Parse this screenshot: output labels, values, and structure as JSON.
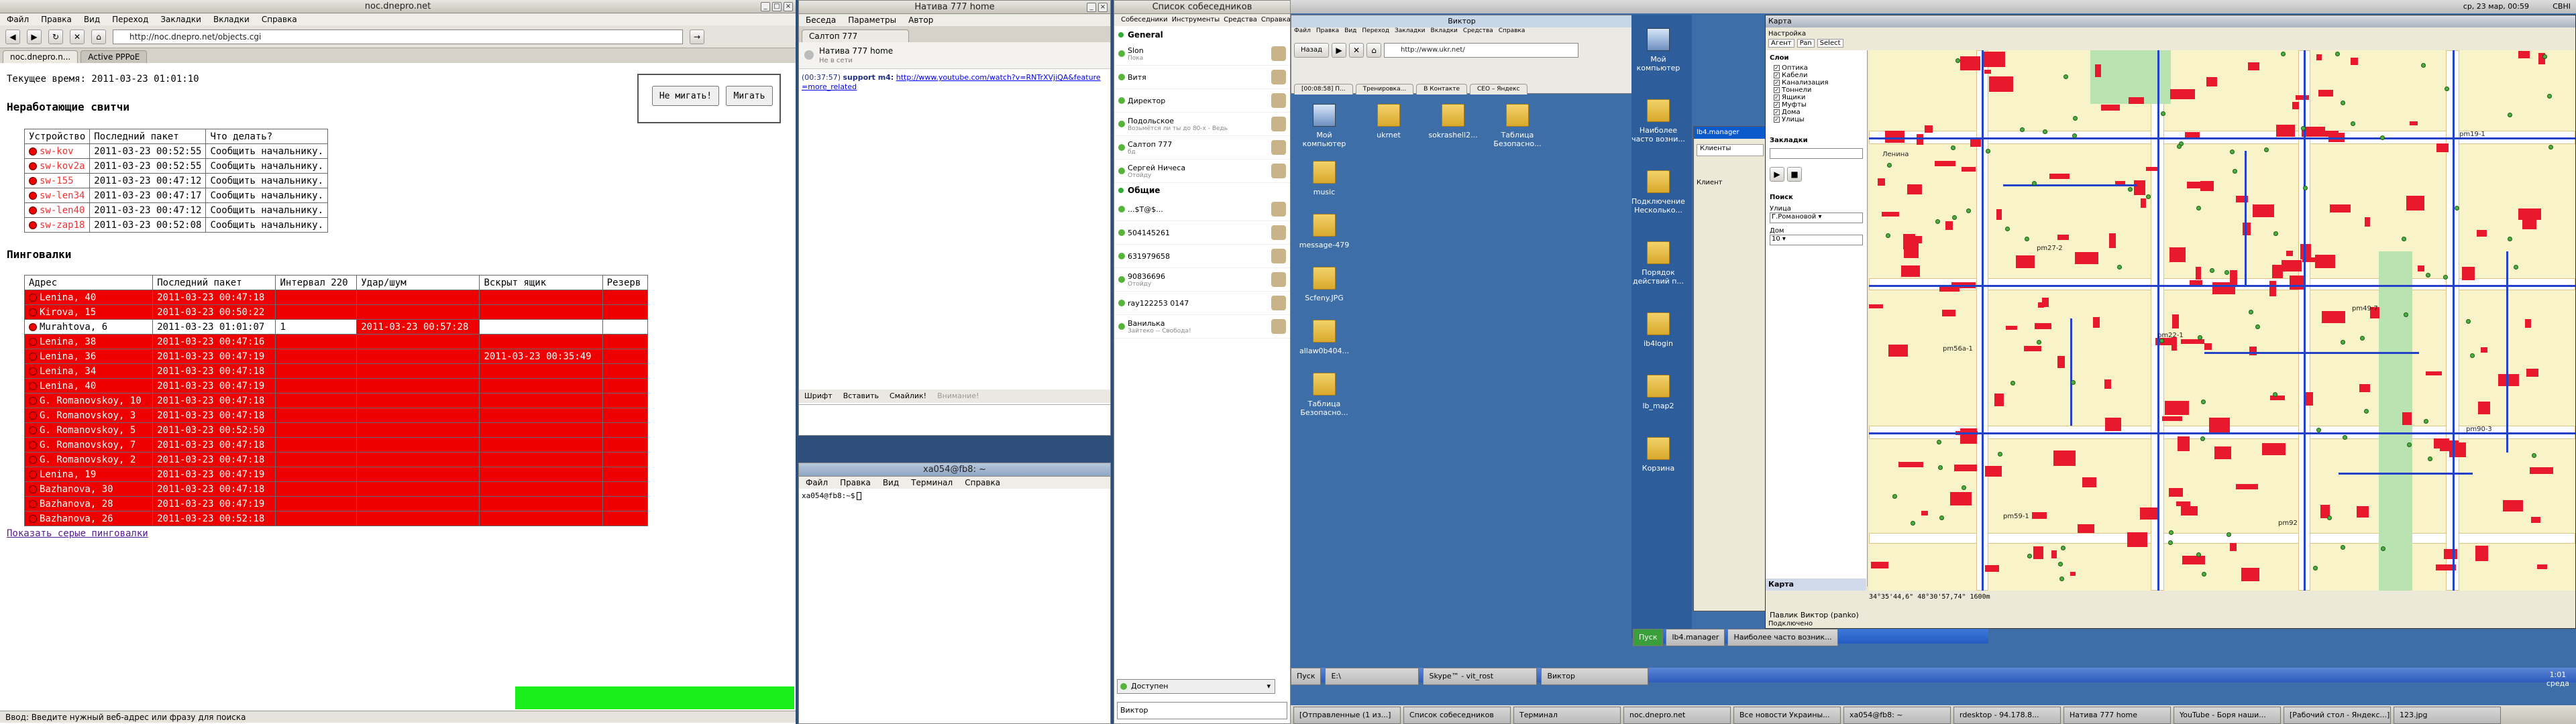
{
  "browser": {
    "title": "noc.dnepro.net",
    "menu": [
      "Файл",
      "Правка",
      "Вид",
      "Переход",
      "Закладки",
      "Вкладки",
      "Справка"
    ],
    "url": "http://noc.dnepro.net/objects.cgi",
    "tabs": [
      {
        "label": "noc.dnepro.n..."
      },
      {
        "label": "Active PPPoE"
      }
    ],
    "current_time_label": "Текущее время: 2011-03-23 01:01:10",
    "btn_no_blink": "Не мигать!",
    "btn_blink": "Мигать",
    "switches_heading": "Неработающие свитчи",
    "switches_headers": [
      "Устройство",
      "Последний пакет",
      "Что делать?"
    ],
    "switches": [
      {
        "device": "sw-kov",
        "last": "2011-03-23 00:52:55",
        "action": "Сообщить начальнику."
      },
      {
        "device": "sw-kov2a",
        "last": "2011-03-23 00:52:55",
        "action": "Сообщить начальнику."
      },
      {
        "device": "sw-155",
        "last": "2011-03-23 00:47:12",
        "action": "Сообщить начальнику."
      },
      {
        "device": "sw-len34",
        "last": "2011-03-23 00:47:17",
        "action": "Сообщить начальнику."
      },
      {
        "device": "sw-len40",
        "last": "2011-03-23 00:47:12",
        "action": "Сообщить начальнику."
      },
      {
        "device": "sw-zap18",
        "last": "2011-03-23 00:52:08",
        "action": "Сообщить начальнику."
      }
    ],
    "ping_heading": "Пинговалки",
    "ping_headers": [
      "Адрес",
      "Последний пакет",
      "Интервал 220",
      "Удар/шум",
      "Вскрыт ящик",
      "Резерв"
    ],
    "pings": [
      {
        "addr": "Lenina, 40",
        "last": "2011-03-23 00:47:18",
        "interval": "",
        "box": ""
      },
      {
        "addr": "Kirova, 15",
        "last": "2011-03-23 00:50:22",
        "interval": "",
        "box": ""
      },
      {
        "addr": "Murahtova, 6",
        "last": "2011-03-23 01:01:07",
        "interval": "1",
        "box": "2011-03-23 00:57:28"
      },
      {
        "addr": "Lenina, 38",
        "last": "2011-03-23 00:47:16",
        "interval": "",
        "box": ""
      },
      {
        "addr": "Lenina, 36",
        "last": "2011-03-23 00:47:19",
        "interval": "",
        "box": "2011-03-23 00:35:49"
      },
      {
        "addr": "Lenina, 34",
        "last": "2011-03-23 00:47:18",
        "interval": "",
        "box": ""
      },
      {
        "addr": "Lenina, 40",
        "last": "2011-03-23 00:47:19",
        "interval": "",
        "box": ""
      },
      {
        "addr": "G. Romanovskoy, 10",
        "last": "2011-03-23 00:47:18",
        "interval": "",
        "box": ""
      },
      {
        "addr": "G. Romanovskoy, 3",
        "last": "2011-03-23 00:47:18",
        "interval": "",
        "box": ""
      },
      {
        "addr": "G. Romanovskoy, 5",
        "last": "2011-03-23 00:52:50",
        "interval": "",
        "box": ""
      },
      {
        "addr": "G. Romanovskoy, 7",
        "last": "2011-03-23 00:47:18",
        "interval": "",
        "box": ""
      },
      {
        "addr": "G. Romanovskoy, 2",
        "last": "2011-03-23 00:47:18",
        "interval": "",
        "box": ""
      },
      {
        "addr": "Lenina, 19",
        "last": "2011-03-23 00:47:19",
        "interval": "",
        "box": ""
      },
      {
        "addr": "Bazhanova, 30",
        "last": "2011-03-23 00:47:18",
        "interval": "",
        "box": ""
      },
      {
        "addr": "Bazhanova, 28",
        "last": "2011-03-23 00:47:19",
        "interval": "",
        "box": ""
      },
      {
        "addr": "Bazhanova, 26",
        "last": "2011-03-23 00:52:18",
        "interval": "",
        "box": ""
      }
    ],
    "show_grey_link": "Показать серые пинговалки",
    "status": "Ввод: Введите нужный веб-адрес или фразу для поиска"
  },
  "chat": {
    "title": "Натива 777 home",
    "menu": [
      "Беседа",
      "Параметры",
      "Автор"
    ],
    "tab": "Салтоп 777",
    "contact_name": "Натива 777 home",
    "contact_status": "Не в сети",
    "message_time": "(00:37:57)",
    "message_sender": "support m4:",
    "message_link": "http://www.youtube.com/watch?v=RNTrXVjiQA&feature=more_related",
    "btn_format": "Шрифт",
    "btn_insert": "Вставить",
    "btn_smile": "Смайлик!",
    "btn_attention": "Внимание!"
  },
  "buddy": {
    "title": "Список собеседников",
    "menu": [
      "Собеседники",
      "Инструменты",
      "Средства",
      "Справка"
    ],
    "group_general": "General",
    "contacts": [
      {
        "name": "Slon",
        "status": "Пока"
      },
      {
        "name": "Витя",
        "status": ""
      },
      {
        "name": "Директор",
        "status": ""
      },
      {
        "name": "Подольское",
        "status": "Возьмётся ли ты до 80-х - Ведь"
      },
      {
        "name": "Салтоп 777",
        "status": "бд"
      },
      {
        "name": "Сергей Ничеса",
        "status": "Отойду"
      }
    ],
    "group_other": "Общие",
    "other_contacts": [
      {
        "name": "...$T@$...",
        "status": ""
      },
      {
        "name": "504145261",
        "status": ""
      },
      {
        "name": "631979658",
        "status": ""
      },
      {
        "name": "90836696",
        "status": "Отойду"
      },
      {
        "name": "ray122253 0147",
        "status": ""
      },
      {
        "name": "Ванилька",
        "status": "Зайтеко -- Свобода!"
      }
    ],
    "availability": "Доступен",
    "status_text": "Виктор"
  },
  "terminal": {
    "title": "xa054@fb8: ~",
    "menu": [
      "Файл",
      "Правка",
      "Вид",
      "Терминал",
      "Справка"
    ],
    "prompt": "xa054@fb8:~$"
  },
  "remote": {
    "title": "Виктор",
    "menu": [
      "Файл",
      "Правка",
      "Вид",
      "Переход",
      "Закладки",
      "Вкладки",
      "Средства",
      "Справка"
    ],
    "nav_back": "Назад",
    "url": "http://www.ukr.net/",
    "tabs": [
      "[00:08:58] П...",
      "Тренировка...",
      "В Контакте",
      "CEO – Яндекс"
    ],
    "desktop_icons": [
      "Мой компьютер",
      "ukrnet",
      "sokrashell2...",
      "Таблица Безопасно..."
    ],
    "desktop_icons2": [
      "music",
      "message-479",
      "Scfeny.JPG",
      "allaw0b404...",
      "Таблица Безопасно..."
    ],
    "net_title": "lb4.manager",
    "net_tab": "Клиенты",
    "net_label": "Клиент",
    "right_icons": [
      "Мой компьютер",
      "Наиболее часто возни...",
      "Подключение Несколько...",
      "Порядок действий п...",
      "ib4login",
      "lb_map2",
      "Корзина"
    ],
    "taskbar_start": "Пуск",
    "taskbar_items": [
      "lb4.manager",
      "Наиболее часто возник..."
    ],
    "bottom_task": [
      "Пуск",
      "E:\\",
      "Skype™ - vit_rost",
      "Виктор"
    ]
  },
  "map": {
    "title": "Карта",
    "inner_title": "Настройка",
    "toolbar": [
      "Агент",
      "Pan",
      "Select"
    ],
    "layers_title": "Слои",
    "layers": [
      "Оптика",
      "Кабели",
      "Канализация",
      "Тоннели",
      "Ящики",
      "Муфты",
      "Дома",
      "Улицы"
    ],
    "bookmarks_title": "Закладки",
    "search_title": "Поиск",
    "street_label": "Улица",
    "street_value": "Г.Романовой",
    "house_label": "Дом",
    "house_value": "10",
    "bottom_panel": "Карта",
    "coords": "34°35'44,6\"  48°30'57,74\"   1600m",
    "status_text": "Павлик Виктор (panko)",
    "ready": "Подключено",
    "street_labels": [
      "Ленина",
      "pm19-1",
      "pm27-2",
      "pm22-1",
      "pm56a-1",
      "pm59-1",
      "pm49-7",
      "pm90-3",
      "pm92"
    ]
  },
  "top_panel": {
    "clock": "ср, 23 мар, 00:59",
    "user": "CBHI"
  },
  "terminal_title": "Терминал",
  "bottom_taskbar": [
    "[Отправленные (1 из...]",
    "Список собеседников",
    "Терминал",
    "noc.dnepro.net",
    "Все новости Украины...",
    "xa054@fb8: ~",
    "rdesktop - 94.178.8...",
    "Натива 777 home",
    "YouTube - Боря наши...",
    "[Рабочий стол - Яндекс...]",
    "123.jpg"
  ],
  "tray": {
    "time": "1:01",
    "day": "среда"
  }
}
